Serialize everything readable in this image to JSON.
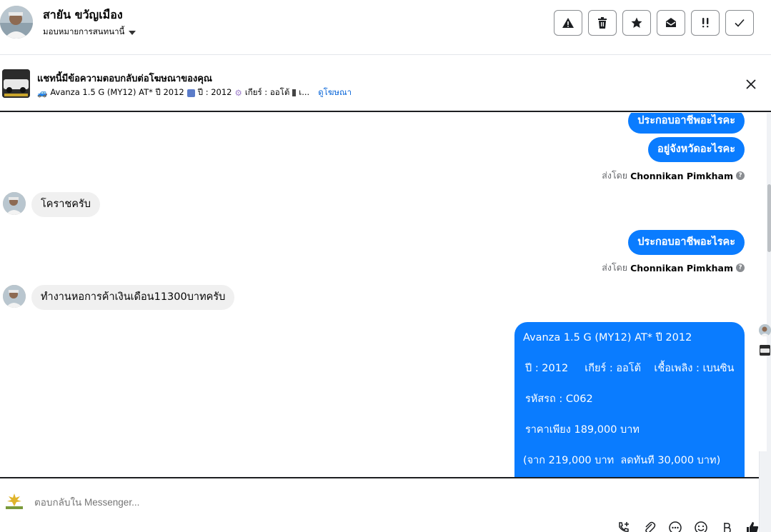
{
  "header": {
    "contact_name": "สายัน ขวัญเมือง",
    "assignee_label": "มอบหมายการสนทนานี้",
    "actions": [
      {
        "name": "report-button",
        "icon": "warning-icon"
      },
      {
        "name": "delete-button",
        "icon": "trash-icon"
      },
      {
        "name": "star-button",
        "icon": "star-icon"
      },
      {
        "name": "mark-unread-button",
        "icon": "envelope-open-icon"
      },
      {
        "name": "follow-up-button",
        "icon": "double-exclamation-icon"
      },
      {
        "name": "mark-done-button",
        "icon": "check-icon"
      }
    ]
  },
  "ad_banner": {
    "title": "แชทนี้มีข้อความตอบกลับต่อโฆษณาของคุณ",
    "model": "Avanza 1.5 G (MY12) AT* ปี 2012",
    "year_text": "ปี : 2012",
    "gear_text": "เกียร์ : ออโต้",
    "truncated_text": "เ...",
    "view_ad_link": "ดูโฆษณา"
  },
  "messages": {
    "out_1": "ประกอบอาชีพอะไรคะ",
    "out_2": "อยู่จังหวัดอะไรคะ",
    "sent_by_prefix": "ส่งโดย",
    "sent_by_name": "Chonnikan Pimkham",
    "in_1": "โคราชครับ",
    "out_3": "ประกอบอาชีพอะไรคะ",
    "in_2": "ทำงานหอการค้าเงินเดือน11300บาทครับ"
  },
  "car_card": {
    "line1": "Avanza 1.5 G (MY12) AT* ปี 2012",
    "line2": "ปี : 2012     เกียร์ : ออโต้    เชื้อเพลิง : เบนซิน",
    "line3": "รหัสรถ : C062",
    "line4": "ราคาเพียง 189,000 บาท",
    "line5": "(จาก 219,000 บาท  ลดทันที 30,000 บาท)"
  },
  "composer": {
    "placeholder": "ตอบกลับใน Messenger..."
  },
  "colors": {
    "brand_blue": "#0a7cff",
    "link_blue": "#0a66d8",
    "incoming_bg": "#f0f0f0"
  }
}
